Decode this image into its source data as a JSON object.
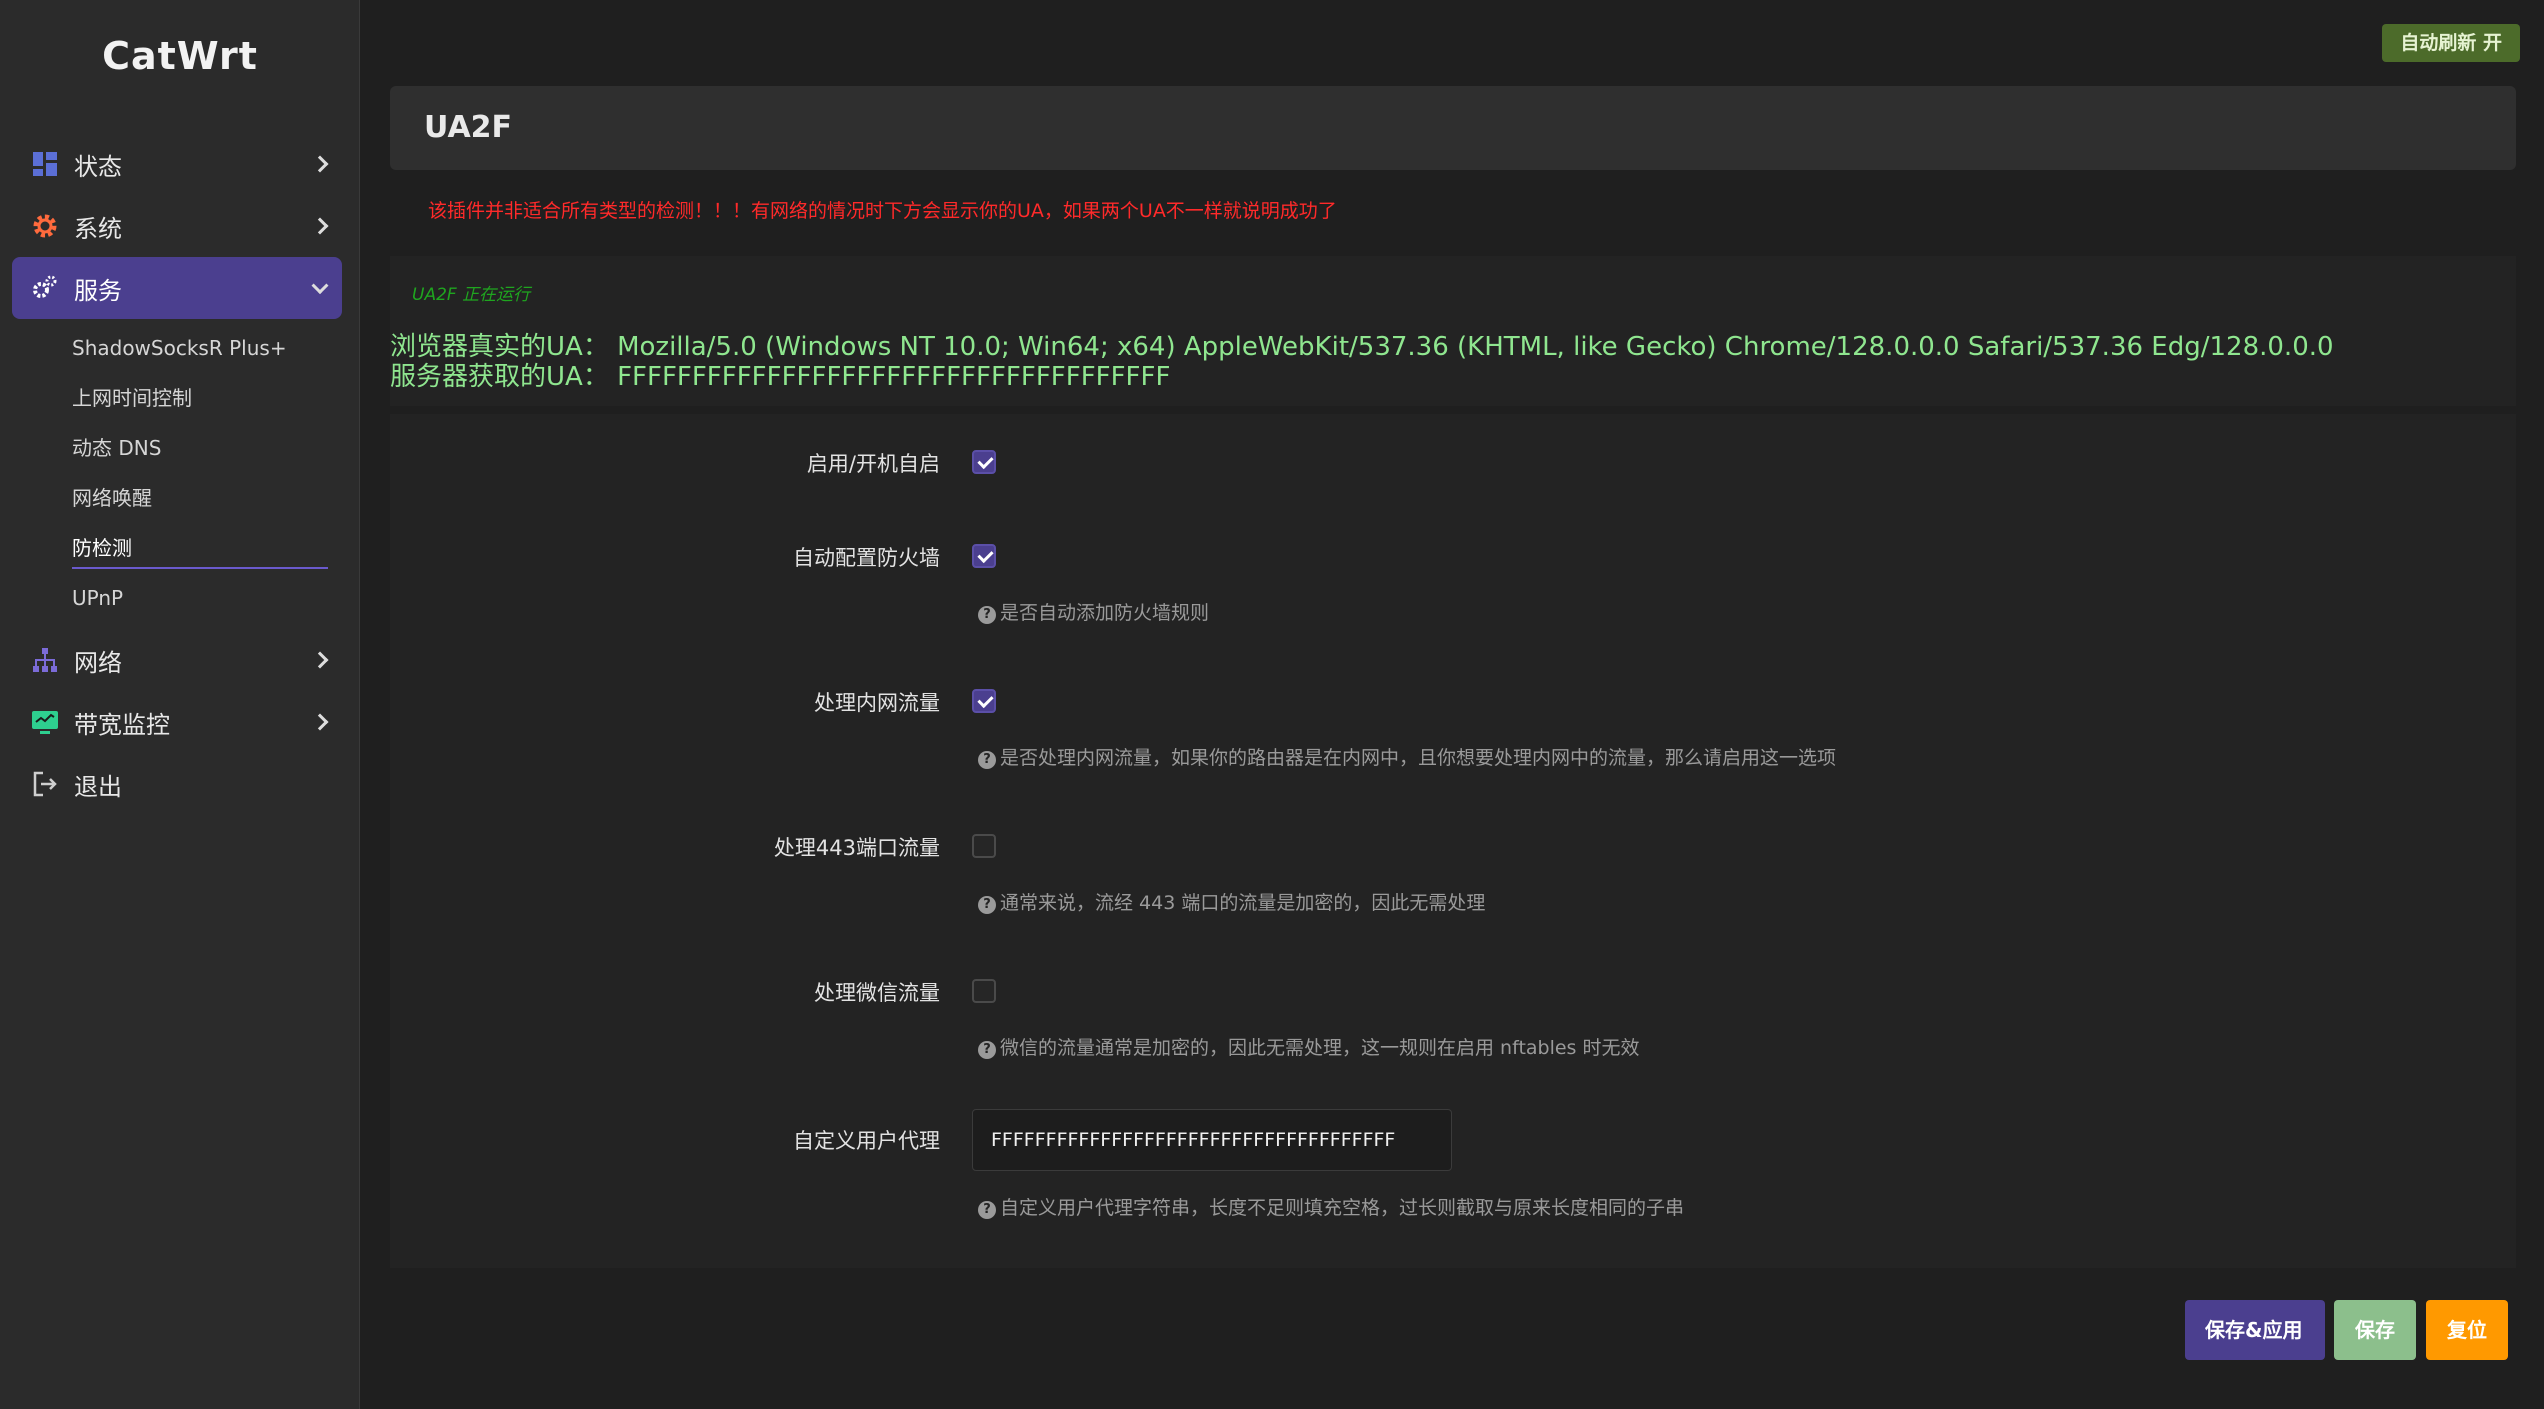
{
  "app": {
    "logo": "CatWrt",
    "auto_refresh": "自动刷新 开"
  },
  "sidebar": {
    "items": [
      {
        "label": "状态",
        "icon": "dashboard-icon"
      },
      {
        "label": "系统",
        "icon": "gear-icon"
      },
      {
        "label": "服务",
        "icon": "gears-icon",
        "active": true
      },
      {
        "label": "网络",
        "icon": "network-icon"
      },
      {
        "label": "带宽监控",
        "icon": "monitor-icon"
      },
      {
        "label": "退出",
        "icon": "logout-icon"
      }
    ],
    "submenu": [
      "ShadowSocksR Plus+",
      "上网时间控制",
      "动态 DNS",
      "网络唤醒",
      "防检测",
      "UPnP"
    ]
  },
  "page": {
    "title": "UA2F",
    "warning": "该插件并非适合所有类型的检测！！！有网络的情况时下方会显示你的UA，如果两个UA不一样就说明成功了",
    "running": "UA2F 正在运行",
    "browser_ua": "浏览器真实的UA：  Mozilla/5.0 (Windows NT 10.0; Win64; x64) AppleWebKit/537.36 (KHTML, like Gecko) Chrome/128.0.0.0 Safari/537.36 Edg/128.0.0.0",
    "server_ua": "服务器获取的UA：  FFFFFFFFFFFFFFFFFFFFFFFFFFFFFFFFFFFFF"
  },
  "form": {
    "enable": {
      "label": "启用/开机自启",
      "checked": true
    },
    "firewall": {
      "label": "自动配置防火墙",
      "checked": true,
      "help": "是否自动添加防火墙规则"
    },
    "intranet": {
      "label": "处理内网流量",
      "checked": true,
      "help": "是否处理内网流量，如果你的路由器是在内网中，且你想要处理内网中的流量，那么请启用这一选项"
    },
    "port443": {
      "label": "处理443端口流量",
      "checked": false,
      "help": "通常来说，流经 443 端口的流量是加密的，因此无需处理"
    },
    "wechat": {
      "label": "处理微信流量",
      "checked": false,
      "help": "微信的流量通常是加密的，因此无需处理，这一规则在启用 nftables 时无效"
    },
    "custom_ua": {
      "label": "自定义用户代理",
      "value": "FFFFFFFFFFFFFFFFFFFFFFFFFFFFFFFFFFFFF",
      "help": "自定义用户代理字符串，长度不足则填充空格，过长则截取与原来长度相同的子串"
    }
  },
  "buttons": {
    "save_apply": "保存&应用",
    "save": "保存",
    "reset": "复位"
  },
  "colors": {
    "accent": "#4b3f8f",
    "warning": "#ff2a2a",
    "ua_text": "#8fe68f",
    "running": "#1fa51f",
    "reset": "#ff9900",
    "save": "#8cbf8c"
  }
}
